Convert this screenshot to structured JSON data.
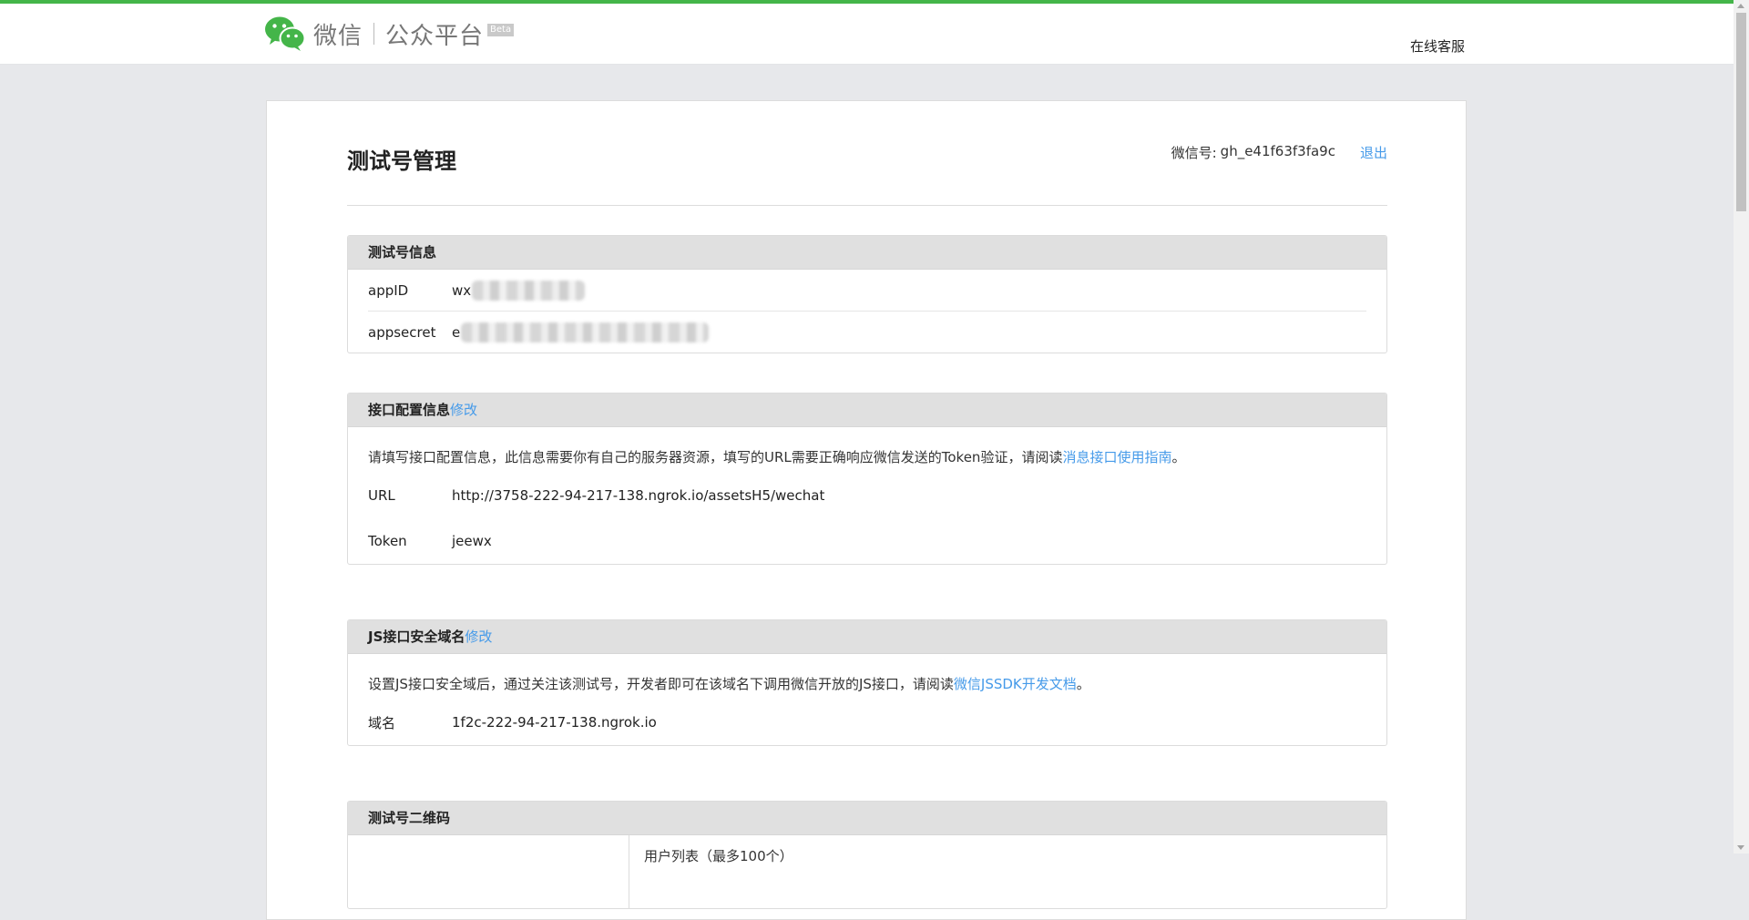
{
  "colors": {
    "accent_green": "#44b549",
    "link_blue": "#459ae9",
    "panel_head_bg": "#e0e0e0",
    "page_bg": "#e7e8eb"
  },
  "header": {
    "logo_icon": "wechat-logo-icon",
    "logo_weixin": "微信",
    "logo_mp": "公众平台",
    "logo_beta": "Beta",
    "service_link": "在线客服"
  },
  "page": {
    "title": "测试号管理",
    "account_label": "微信号:",
    "account_id": "gh_e41f63f3fa9c",
    "logout": "退出"
  },
  "test_info": {
    "title": "测试号信息",
    "rows": [
      {
        "label": "appID",
        "value_visible": "wx"
      },
      {
        "label": "appsecret",
        "value_visible": "e"
      }
    ]
  },
  "interface_config": {
    "title": "接口配置信息",
    "edit": "修改",
    "desc_before": "请填写接口配置信息，此信息需要你有自己的服务器资源，填写的URL需要正确响应微信发送的Token验证，请阅读",
    "desc_link": "消息接口使用指南",
    "desc_after": "。",
    "url_label": "URL",
    "url_value": "http://3758-222-94-217-138.ngrok.io/assetsH5/wechat",
    "token_label": "Token",
    "token_value": "jeewx"
  },
  "js_domain": {
    "title": "JS接口安全域名",
    "edit": "修改",
    "desc_before": "设置JS接口安全域后，通过关注该测试号，开发者即可在该域名下调用微信开放的JS接口，请阅读",
    "desc_link": "微信JSSDK开发文档",
    "desc_after": "。",
    "domain_label": "域名",
    "domain_value": "1f2c-222-94-217-138.ngrok.io"
  },
  "qr_code": {
    "title": "测试号二维码",
    "user_list": "用户列表（最多100个）"
  }
}
